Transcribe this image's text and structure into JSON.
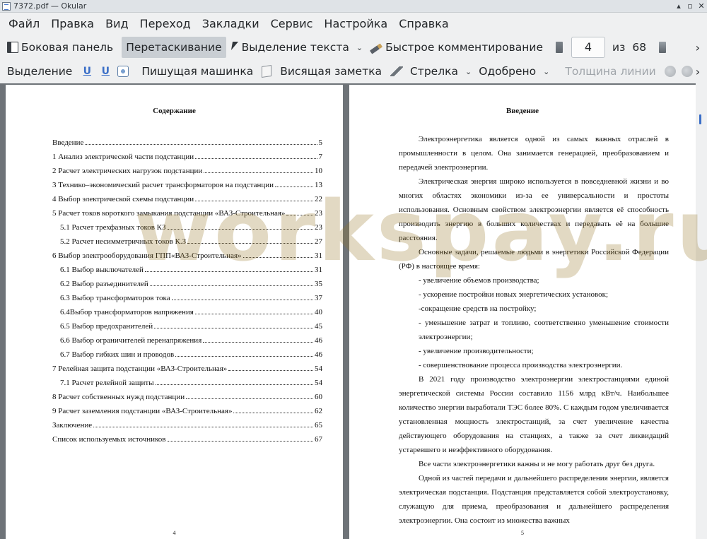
{
  "window": {
    "title": "7372.pdf  — Okular",
    "controls": [
      "▴",
      "▫",
      "✕"
    ]
  },
  "menu": [
    "Файл",
    "Правка",
    "Вид",
    "Переход",
    "Закладки",
    "Сервис",
    "Настройка",
    "Справка"
  ],
  "toolbar1": {
    "sidebar": "Боковая панель",
    "drag": "Перетаскивание",
    "text_select": "Выделение текста",
    "quick_comment": "Быстрое комментирование",
    "page_current": "4",
    "page_of": "из",
    "page_total": "68"
  },
  "toolbar2": {
    "selection": "Выделение",
    "typewriter": "Пишущая машинка",
    "pinned_note": "Висящая заметка",
    "arrow": "Стрелка",
    "approved": "Одобрено",
    "line_width": "Толщина линии"
  },
  "left_page": {
    "heading": "Содержание",
    "page_number": "4",
    "toc": [
      {
        "title": "Введение",
        "page": "5",
        "indent": false
      },
      {
        "title": "1 Анализ электрической части подстанции",
        "page": "7",
        "indent": false
      },
      {
        "title": "2 Расчет электрических нагрузок подстанции",
        "page": "10",
        "indent": false
      },
      {
        "title": "3 Технико–экономический расчет трансформаторов на подстанции",
        "page": "13",
        "indent": false
      },
      {
        "title": "4 Выбор электрической схемы подстанции",
        "page": "22",
        "indent": false
      },
      {
        "title": "5 Расчет токов короткого замыкания подстанции «ВАЗ-Строительная»",
        "page": "23",
        "indent": false
      },
      {
        "title": "5.1 Расчет трехфазных токов КЗ",
        "page": "23",
        "indent": true
      },
      {
        "title": "5.2 Расчет несимметричных токов К.З",
        "page": "27",
        "indent": true
      },
      {
        "title": "6 Выбор электрооборудования ГПП«ВАЗ-Строительная»",
        "page": "31",
        "indent": false
      },
      {
        "title": "6.1 Выбор выключателей",
        "page": "31",
        "indent": true
      },
      {
        "title": "6.2 Выбор разъединителей",
        "page": "35",
        "indent": true
      },
      {
        "title": "6.3 Выбор трансформаторов тока",
        "page": "37",
        "indent": true
      },
      {
        "title": "6.4Выбор трансформаторов напряжения",
        "page": "40",
        "indent": true
      },
      {
        "title": "6.5 Выбор предохранителей",
        "page": "45",
        "indent": true
      },
      {
        "title": "6.6 Выбор ограничителей перенапряжения",
        "page": "46",
        "indent": true
      },
      {
        "title": "6.7 Выбор гибких шин и проводов",
        "page": "46",
        "indent": true
      },
      {
        "title": "7 Релейная защита подстанции «ВАЗ-Строительная»",
        "page": "54",
        "indent": false
      },
      {
        "title": "7.1 Расчет релейной защиты",
        "page": "54",
        "indent": true
      },
      {
        "title": "8 Расчет собственных нужд подстанции",
        "page": "60",
        "indent": false
      },
      {
        "title": "9 Расчет заземления подстанции «ВАЗ-Строительная»",
        "page": "62",
        "indent": false
      },
      {
        "title": "Заключение",
        "page": "65",
        "indent": false
      },
      {
        "title": "Список используемых источников",
        "page": "67",
        "indent": false
      }
    ]
  },
  "right_page": {
    "heading": "Введение",
    "page_number": "5",
    "lines": [
      {
        "text": "Электроэнергетика является одной из самых важных отраслей в промышленности в целом. Она занимается генерацией, преобразованием и передачей электроэнергии.",
        "kind": "p"
      },
      {
        "text": "Электрическая энергия широко используется в повседневной жизни и во многих областях экономики из-за ее универсальности и простоты использования. Основным свойством электроэнергии является её способность производить энергию в больших количествах и передавать её на большие расстояния.",
        "kind": "p"
      },
      {
        "text": "Основные задачи, решаемые людьми в энергетики Российской Федерации (РФ) в настоящее время:",
        "kind": "p"
      },
      {
        "text": "- увеличение объемов производства;",
        "kind": "li"
      },
      {
        "text": "- ускорение постройки новых энергетических установок;",
        "kind": "li"
      },
      {
        "text": "-сокращение средств на постройку;",
        "kind": "li"
      },
      {
        "text": "- уменьшение затрат и топливо, соответственно уменьшение стоимости электроэнергии;",
        "kind": "li"
      },
      {
        "text": "- увеличение производительности;",
        "kind": "li"
      },
      {
        "text": "- совершенствование процесса производства электроэнергии.",
        "kind": "li"
      },
      {
        "text": "В 2021 году производство электроэнергии электростанциями единой энергетической системы России составило 1156 млрд кВт/ч. Наибольшее количество энергии выработали ТЭС более 80%. С каждым годом увеличивается установленная мощность электростанций, за счет увеличение качества действующего оборудования на станциях, а также за счет ликвидаций устаревшего и неэффективного оборудования.",
        "kind": "p"
      },
      {
        "text": "Все части электроэнергетики важны и не могу работать друг без друга.",
        "kind": "p"
      },
      {
        "text": "Одной из частей передачи и дальнейшего распределения энергии, является электрическая подстанция. Подстанция представляется собой электроустановку, служащую для приема, преобразования и дальнейшего распределения электроэнергии. Она состоит из множества важных",
        "kind": "p"
      }
    ]
  },
  "watermark": "workspay.ru"
}
